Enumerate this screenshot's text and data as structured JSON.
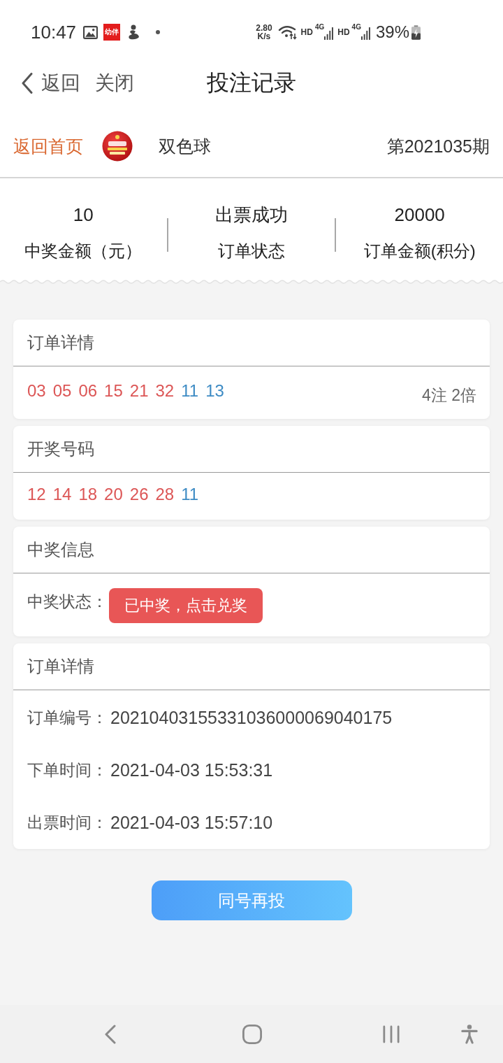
{
  "status_bar": {
    "time": "10:47",
    "notification_badge": "幼伴",
    "net_speed": {
      "value": "2.80",
      "unit": "K/s"
    },
    "signals": [
      {
        "label": "HD",
        "network": "4G"
      },
      {
        "label": "HD",
        "network": "4G"
      }
    ],
    "battery": "39%"
  },
  "nav_header": {
    "back": "返回",
    "close": "关闭",
    "title": "投注记录"
  },
  "lottery_bar": {
    "home_link": "返回首页",
    "name": "双色球",
    "issue": "第2021035期"
  },
  "summary": [
    {
      "value": "10",
      "label": "中奖金额（元）"
    },
    {
      "value": "出票成功",
      "label": "订单状态"
    },
    {
      "value": "20000",
      "label": "订单金额(积分)"
    }
  ],
  "bet_card": {
    "title": "订单详情",
    "numbers": [
      {
        "text": "03",
        "color": "#dc5656"
      },
      {
        "text": "05",
        "color": "#dc5656"
      },
      {
        "text": "06",
        "color": "#dc5656"
      },
      {
        "text": "15",
        "color": "#dc5656"
      },
      {
        "text": "21",
        "color": "#dc5656"
      },
      {
        "text": "32",
        "color": "#dc5656"
      },
      {
        "text": "11",
        "color": "#3d8bc4"
      },
      {
        "text": "13",
        "color": "#3d8bc4"
      }
    ],
    "multiplier": "4注 2倍"
  },
  "draw_card": {
    "title": "开奖号码",
    "numbers": [
      {
        "text": "12",
        "color": "#dc5656"
      },
      {
        "text": "14",
        "color": "#dc5656"
      },
      {
        "text": "18",
        "color": "#dc5656"
      },
      {
        "text": "20",
        "color": "#dc5656"
      },
      {
        "text": "26",
        "color": "#dc5656"
      },
      {
        "text": "28",
        "color": "#dc5656"
      },
      {
        "text": "11",
        "color": "#3d8bc4"
      }
    ]
  },
  "prize_card": {
    "title": "中奖信息",
    "label": "中奖状态：",
    "action": "已中奖，点击兑奖"
  },
  "order_card": {
    "title": "订单详情",
    "fields": [
      {
        "label": "订单编号：",
        "value": "20210403155331036000069040175"
      },
      {
        "label": "下单时间：",
        "value": "2021-04-03 15:53:31"
      },
      {
        "label": "出票时间：",
        "value": "2021-04-03 15:57:10"
      }
    ]
  },
  "repeat_button": {
    "label": "同号再投"
  }
}
